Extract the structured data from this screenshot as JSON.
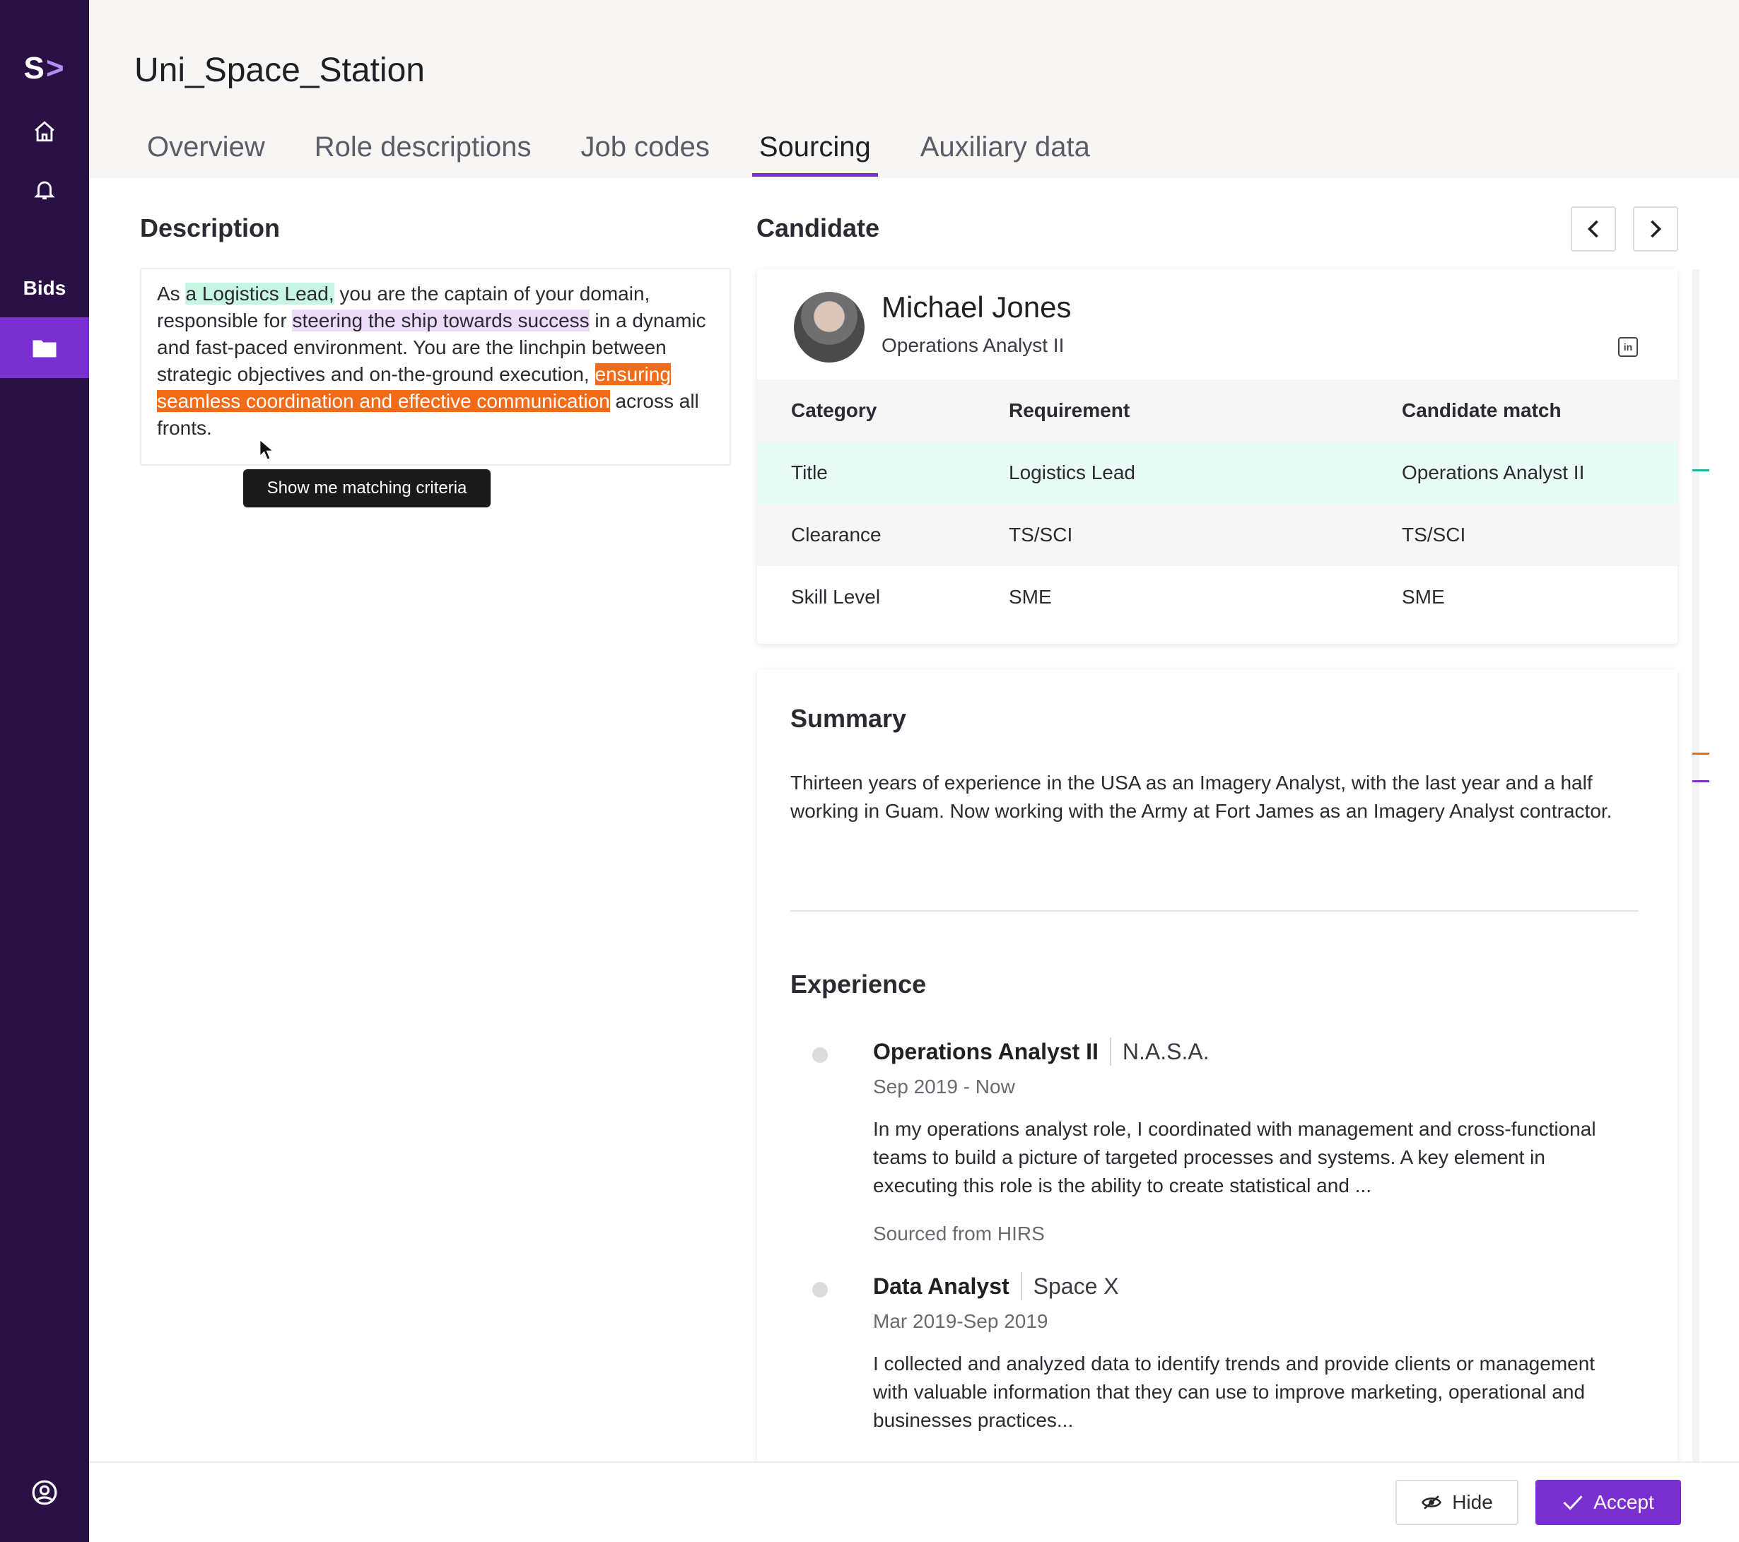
{
  "sidebar": {
    "logo_letter": "S",
    "logo_chevron": ">",
    "bids_label": "Bids",
    "icons": [
      "home-icon",
      "bell-icon",
      "folder-icon",
      "user-circle-icon"
    ]
  },
  "header": {
    "title": "Uni_Space_Station",
    "tabs": [
      {
        "label": "Overview"
      },
      {
        "label": "Role descriptions"
      },
      {
        "label": "Job codes"
      },
      {
        "label": "Sourcing"
      },
      {
        "label": "Auxiliary data"
      }
    ],
    "active_tab": "Sourcing"
  },
  "description": {
    "heading": "Description",
    "seg1": "As ",
    "hl1": "a Logistics Lead,",
    "seg2": " you are the captain of your domain, responsible for ",
    "hl2": "steering the ship towards success",
    "seg3": " in a dynamic and fast-paced environment. You are the linchpin between strategic objectives and on-the-ground execution, ",
    "hl3": "ensuring seamless coordination and effective communication",
    "seg4": " across all fronts.",
    "tooltip": "Show me matching criteria"
  },
  "candidate": {
    "heading": "Candidate",
    "name": "Michael Jones",
    "title": "Operations Analyst II",
    "linkedin_glyph": "in",
    "table": {
      "headers": [
        "Category",
        "Requirement",
        "Candidate match"
      ],
      "rows": [
        [
          "Title",
          "Logistics Lead",
          "Operations Analyst II"
        ],
        [
          "Clearance",
          "TS/SCI",
          "TS/SCI"
        ],
        [
          "Skill Level",
          "SME",
          "SME"
        ]
      ]
    }
  },
  "summary": {
    "heading": "Summary",
    "text": "Thirteen years of experience in the USA as an Imagery Analyst, with the last year and a half working in Guam. Now working with the Army at Fort James as an Imagery Analyst contractor."
  },
  "experience": {
    "heading": "Experience",
    "items": [
      {
        "role": "Operations Analyst II",
        "org": "N.A.S.A.",
        "dates": "Sep 2019 - Now",
        "desc": "In my operations analyst role, I coordinated with management and cross-functional teams to build a picture of targeted processes and systems. A key element in executing this role is the ability to create statistical and ...",
        "source": "Sourced from HIRS"
      },
      {
        "role": "Data Analyst",
        "org": "Space X",
        "dates": "Mar 2019-Sep 2019",
        "desc": "I collected and analyzed data to identify trends and provide clients or management with valuable information that they can use to improve marketing, operational and businesses practices..."
      }
    ]
  },
  "footer": {
    "hide_label": "Hide",
    "accept_label": "Accept"
  },
  "colors": {
    "sidebar_bg": "#2a1145",
    "accent": "#7a2fd0",
    "highlight_green": "#c6f5e4",
    "highlight_purple": "#ecdcf8",
    "highlight_orange": "#f36b16",
    "scroll_mark_green": "#1db89a",
    "scroll_mark_orange": "#f36b16",
    "scroll_mark_purple": "#7a2fd0"
  }
}
